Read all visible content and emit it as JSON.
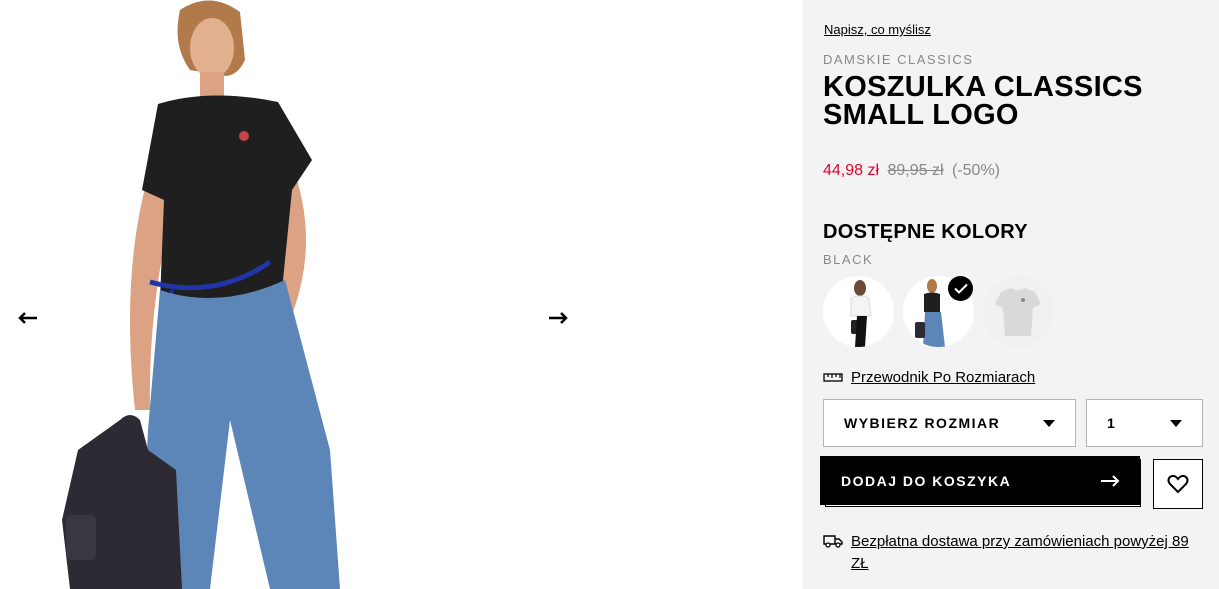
{
  "gallery": {
    "prev_icon": "arrow-left-icon",
    "next_icon": "arrow-right-icon"
  },
  "product": {
    "review_link": "Napisz, co myślisz",
    "category": "DAMSKIE CLASSICS",
    "title": "KOSZULKA CLASSICS SMALL LOGO",
    "price_sale": "44,98 zł",
    "price_old": "89,95 zł",
    "discount": "(-50%)",
    "colors_heading": "DOSTĘPNE KOLORY",
    "selected_color": "BLACK",
    "size_guide": "Przewodnik Po Rozmiarach",
    "size_select": "WYBIERZ ROZMIAR",
    "quantity": "1",
    "add_to_cart": "DODAJ DO KOSZYKA",
    "shipping": "Bezpłatna dostawa przy zamówieniach powyżej 89 ZŁ"
  },
  "colors": {
    "sale": "#e4002b",
    "muted": "#888888",
    "panel_bg": "#f3f3f3"
  }
}
